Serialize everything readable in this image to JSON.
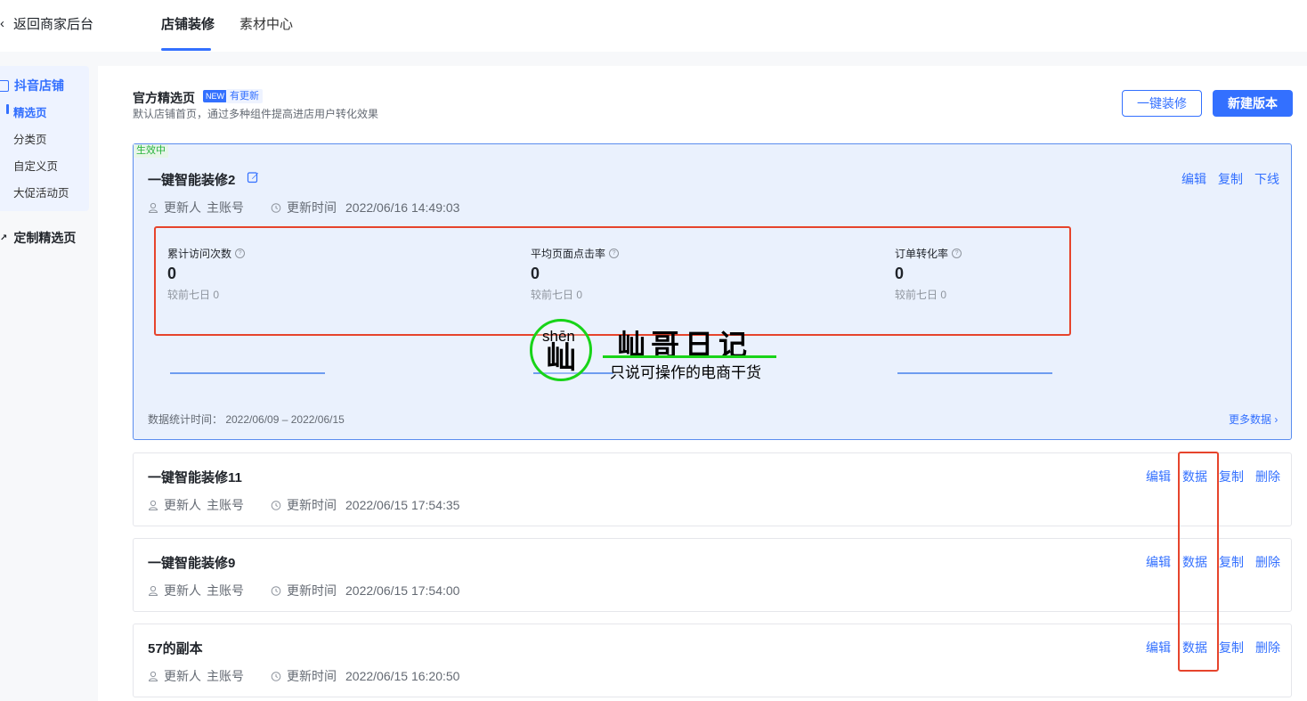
{
  "header": {
    "back_label": "返回商家后台",
    "tabs": [
      {
        "label": "店铺装修",
        "active": true
      },
      {
        "label": "素材中心",
        "active": false
      }
    ]
  },
  "sidebar": {
    "group_title": "抖音店铺",
    "items": [
      "精选页",
      "分类页",
      "自定义页",
      "大促活动页"
    ],
    "active_item": "精选页",
    "custom_group": "定制精选页"
  },
  "section": {
    "title": "官方精选页",
    "new_badge": "NEW",
    "update_badge": "有更新",
    "description": "默认店铺首页，通过多种组件提高进店用户转化效果",
    "btn_one_click": "一键装修",
    "btn_new_version": "新建版本"
  },
  "active_version": {
    "status": "生效中",
    "name": "一键智能装修2",
    "updater_label": "更新人",
    "updater": "主账号",
    "time_label": "更新时间",
    "time": "2022/06/16 14:49:03",
    "actions": [
      "编辑",
      "复制",
      "下线"
    ],
    "stats": [
      {
        "label": "累计访问次数",
        "value": "0",
        "compare": "较前七日 0"
      },
      {
        "label": "平均页面点击率",
        "value": "0",
        "compare": "较前七日 0"
      },
      {
        "label": "订单转化率",
        "value": "0",
        "compare": "较前七日 0"
      }
    ],
    "stat_range": "数据统计时间： 2022/06/09 – 2022/06/15",
    "more_link": "更多数据"
  },
  "versions": [
    {
      "name": "一键智能装修11",
      "updater_label": "更新人",
      "updater": "主账号",
      "time_label": "更新时间",
      "time": "2022/06/15 17:54:35",
      "actions": [
        "编辑",
        "数据",
        "复制",
        "删除"
      ]
    },
    {
      "name": "一键智能装修9",
      "updater_label": "更新人",
      "updater": "主账号",
      "time_label": "更新时间",
      "time": "2022/06/15 17:54:00",
      "actions": [
        "编辑",
        "数据",
        "复制",
        "删除"
      ]
    },
    {
      "name": "57的副本",
      "updater_label": "更新人",
      "updater": "主账号",
      "time_label": "更新时间",
      "time": "2022/06/15 16:20:50",
      "actions": [
        "编辑",
        "数据",
        "复制",
        "删除"
      ]
    }
  ],
  "watermark": {
    "pinyin": "shēn",
    "char": "屾",
    "title": "屾哥日记",
    "subtitle": "只说可操作的电商干货"
  },
  "colors": {
    "accent": "#3370ff",
    "highlight_border": "#e6442c",
    "live_green": "#26b33b"
  }
}
